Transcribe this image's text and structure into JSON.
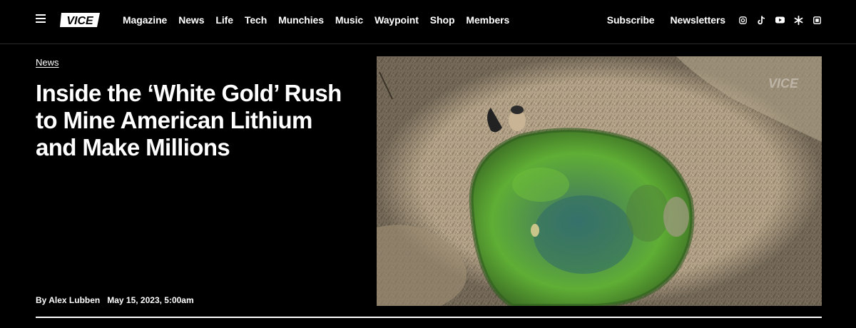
{
  "header": {
    "logo_text": "VICE",
    "nav": [
      "Magazine",
      "News",
      "Life",
      "Tech",
      "Munchies",
      "Music",
      "Waypoint",
      "Shop",
      "Members"
    ],
    "subscribe_label": "Subscribe",
    "newsletters_label": "Newsletters",
    "socials": [
      "instagram-icon",
      "tiktok-icon",
      "youtube-icon",
      "asterisk-icon",
      "flipboard-icon"
    ]
  },
  "article": {
    "category": "News",
    "headline": "Inside the ‘White Gold’ Rush to Mine American Lithium and Make Millions",
    "author": "By Alex Lubben",
    "date": "May 15, 2023, 5:00am"
  },
  "hero": {
    "watermark": "VICE"
  }
}
